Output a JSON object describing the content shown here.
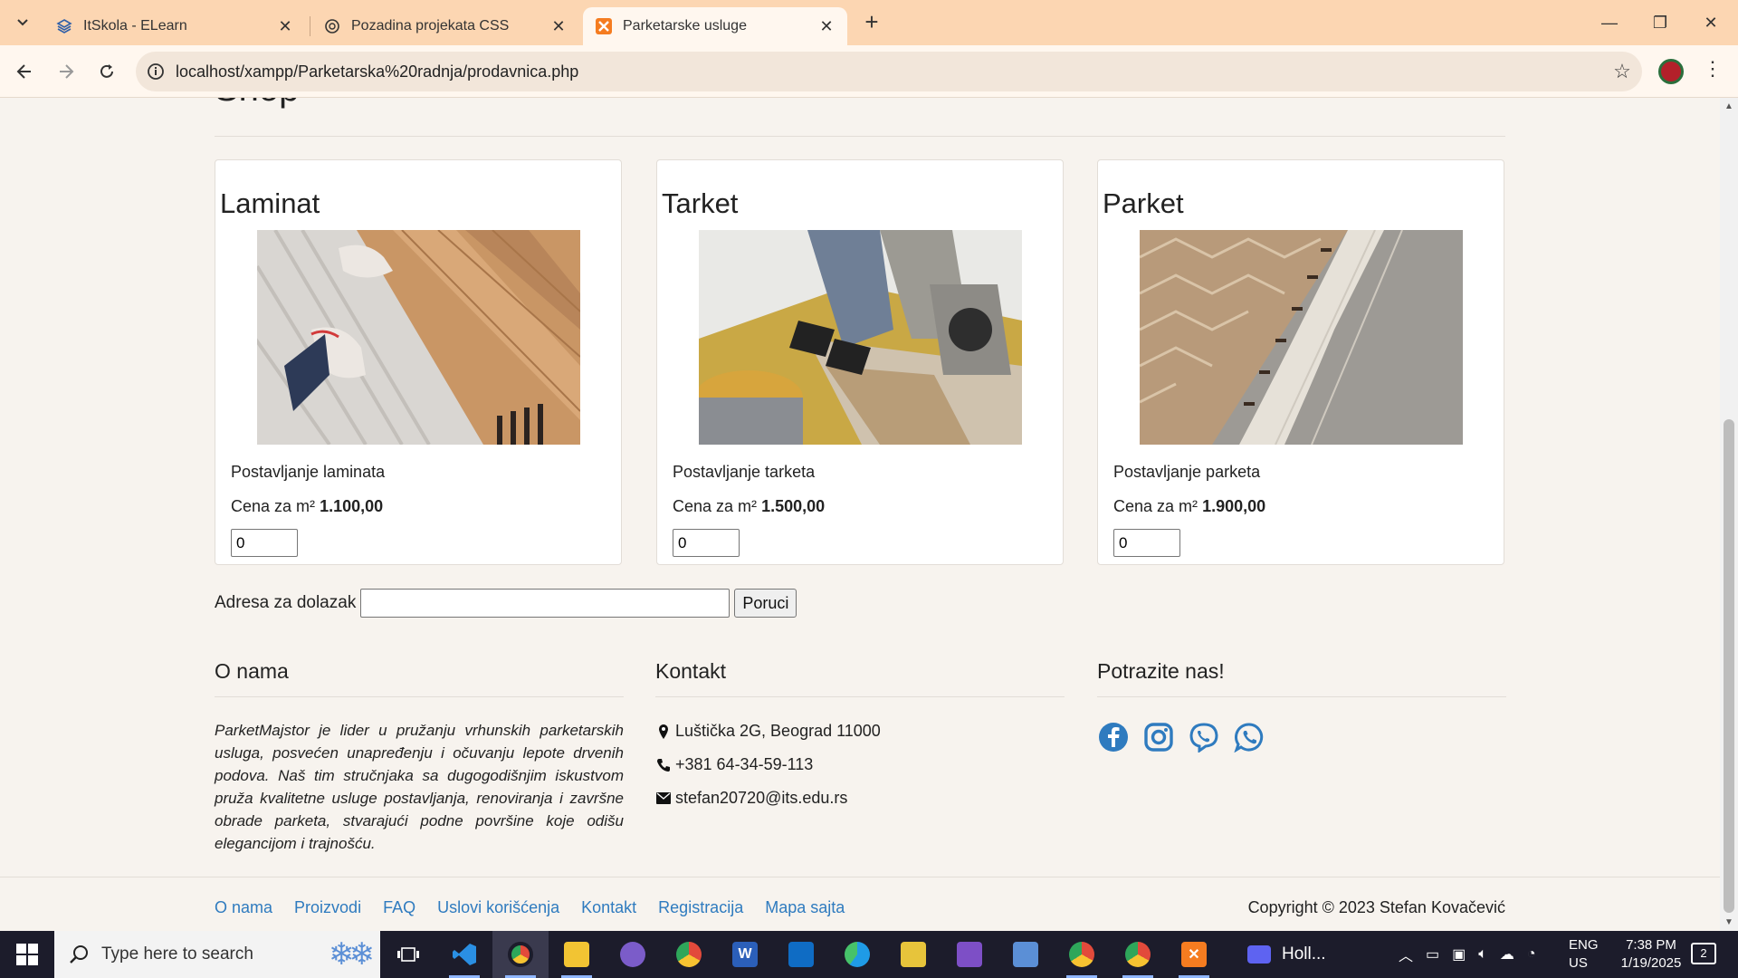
{
  "browser": {
    "tabs": [
      {
        "title": "ItSkola - ELearn",
        "active": false
      },
      {
        "title": "Pozadina projekata CSS",
        "active": false
      },
      {
        "title": "Parketarske usluge",
        "active": true
      }
    ],
    "url": "localhost/xampp/Parketarska%20radnja/prodavnica.php"
  },
  "page": {
    "shop_title": "Shop",
    "products": [
      {
        "name": "Laminat",
        "description": "Postavljanje laminata",
        "price_label": "Cena za m²",
        "price": "1.100,00",
        "quantity": "0"
      },
      {
        "name": "Tarket",
        "description": "Postavljanje tarketa",
        "price_label": "Cena za m²",
        "price": "1.500,00",
        "quantity": "0"
      },
      {
        "name": "Parket",
        "description": "Postavljanje parketa",
        "price_label": "Cena za m²",
        "price": "1.900,00",
        "quantity": "0"
      }
    ],
    "order": {
      "address_label": "Adresa za dolazak",
      "address_value": "",
      "submit_label": "Poruci"
    },
    "footer": {
      "about_title": "O nama",
      "about_text": "ParketMajstor je lider u pružanju vrhunskih parketarskih usluga, posvećen unapređenju i očuvanju lepote drvenih podova. Naš tim stručnjaka sa dugogodišnjim iskustvom pruža kvalitetne usluge postavljanja, renoviranja i završne obrade parketa, stvarajući podne površine koje odišu elegancijom i trajnošću.",
      "contact_title": "Kontakt",
      "address": "Luštička 2G, Beograd 11000",
      "phone": "+381 64-34-59-113",
      "email": "stefan20720@its.edu.rs",
      "social_title": "Potrazite nas!",
      "social": [
        "facebook-icon",
        "instagram-icon",
        "viber-icon",
        "whatsapp-icon"
      ],
      "links": [
        "O nama",
        "Proizvodi",
        "FAQ",
        "Uslovi korišćenja",
        "Kontakt",
        "Registracija",
        "Mapa sajta"
      ],
      "copyright": "Copyright © 2023 Stefan Kovačević"
    }
  },
  "taskbar": {
    "search_placeholder": "Type here to search",
    "running_app": "Holl...",
    "lang_line1": "ENG",
    "lang_line2": "US",
    "time": "7:38 PM",
    "date": "1/19/2025",
    "notifications": "2"
  },
  "colors": {
    "tabbar": "#fcd6b2",
    "link": "#2f7bbf",
    "taskbar": "#1c1c2b"
  }
}
